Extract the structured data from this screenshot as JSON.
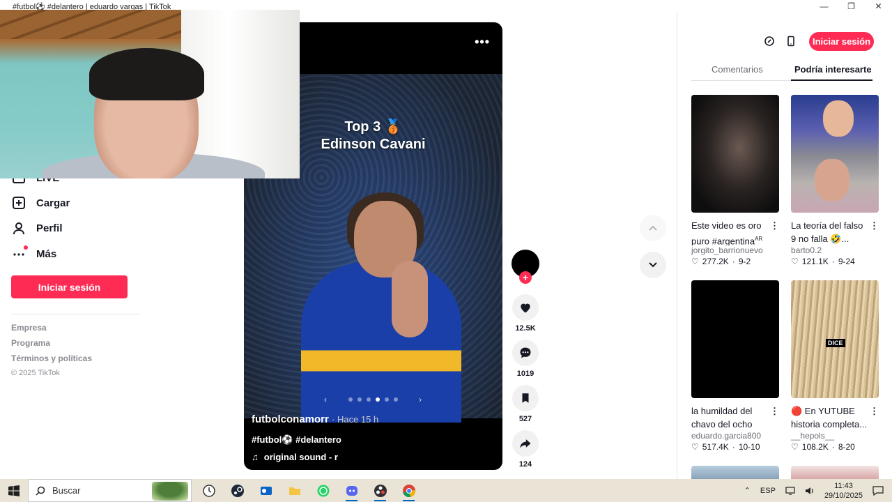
{
  "window": {
    "title": "#futbol⚽ #delantero | eduardo vargas | TikTok",
    "minimize": "—",
    "maximize": "❐",
    "close": "✕"
  },
  "sidebar": {
    "items": [
      {
        "label": "LIVE",
        "icon": "live-icon"
      },
      {
        "label": "Cargar",
        "icon": "upload-icon"
      },
      {
        "label": "Perfil",
        "icon": "profile-icon"
      },
      {
        "label": "Más",
        "icon": "more-icon"
      }
    ],
    "login_label": "Iniciar sesión",
    "footer": [
      "Empresa",
      "Programa",
      "Términos y políticas"
    ],
    "copyright": "© 2025 TikTok"
  },
  "video": {
    "overlay_line1": "Top 3 🥉",
    "overlay_line2": "Edinson Cavani",
    "author": "futbolconamorr",
    "time": "· Hace 15 h",
    "tags": "#futbol⚽ #delantero",
    "sound": "original sound - r",
    "carousel_prev": "‹",
    "carousel_next": "›",
    "carousel_total": 6,
    "carousel_active": 3
  },
  "actions": {
    "likes": "12.5K",
    "comments": "1019",
    "saves": "527",
    "shares": "124"
  },
  "right_panel": {
    "login_label": "Iniciar sesión",
    "tabs": [
      "Comentarios",
      "Podría interesarte"
    ],
    "active_tab": 1,
    "recommendations": [
      {
        "title": "Este video es oro puro #argentina",
        "title_sup": "AR",
        "user": "jorgito_barrionuevo",
        "likes": "277.2K",
        "date": "9-2"
      },
      {
        "title": "La teoría del falso 9 no falla 🤣...",
        "user": "barto0.2",
        "likes": "121.1K",
        "date": "9-24"
      },
      {
        "title": "la humildad del chavo del ocho",
        "user": "eduardo.garcia800",
        "likes": "517.4K",
        "date": "10-10"
      },
      {
        "title": "🔴 En YUTUBE historia completa...",
        "user": "__hepols__",
        "likes": "108.2K",
        "date": "8-20",
        "thumb_text": "DICE"
      }
    ]
  },
  "taskbar": {
    "search_placeholder": "Buscar",
    "language": "ESP",
    "time": "11:43",
    "date": "29/10/2025"
  },
  "colors": {
    "accent": "#fe2c55",
    "text": "#161823",
    "muted": "#8a8b91"
  }
}
